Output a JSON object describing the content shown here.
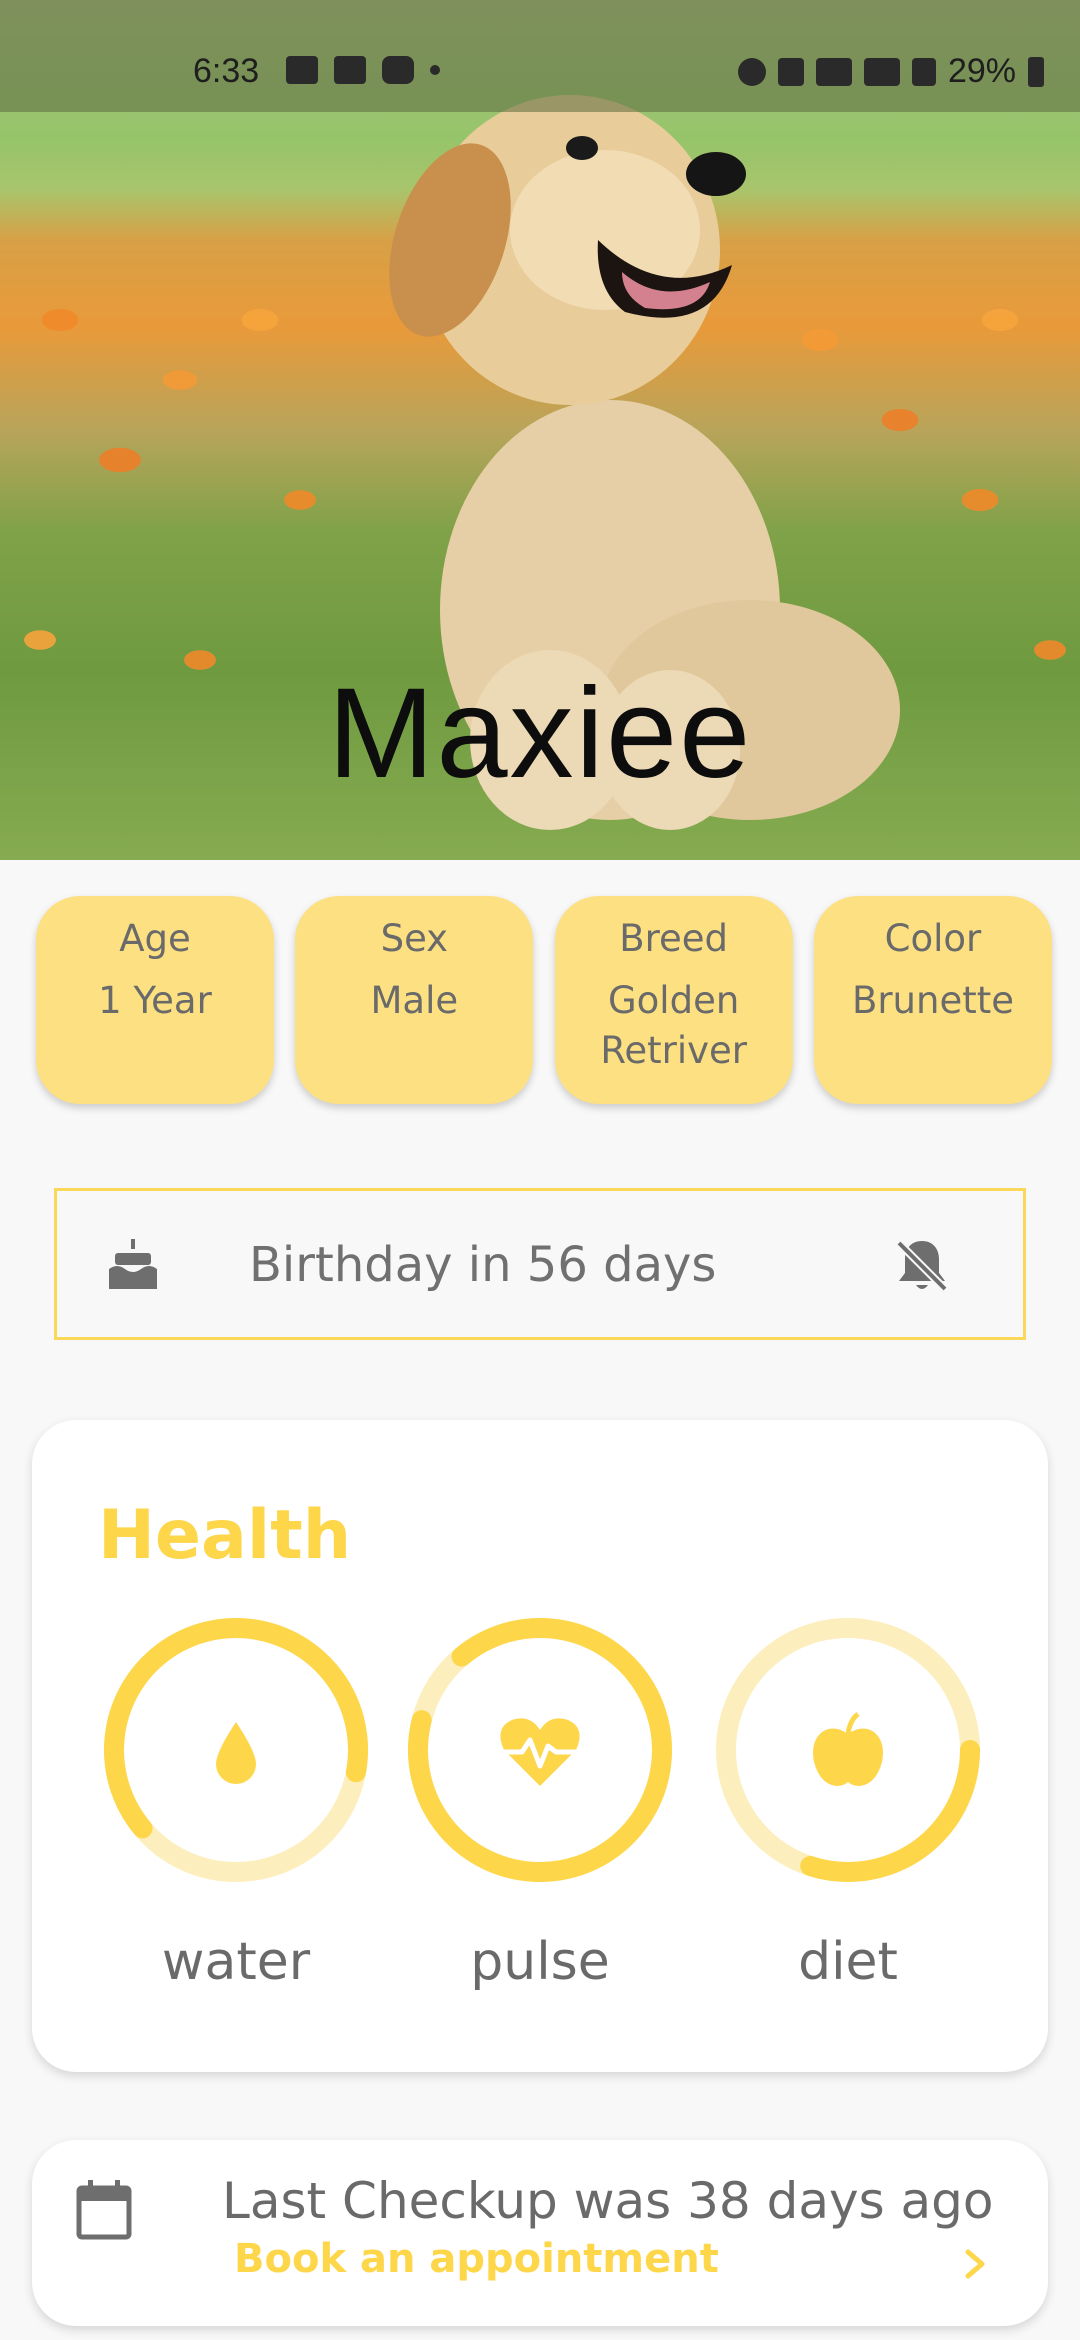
{
  "status_bar": {
    "time": "6:33",
    "battery": "29%",
    "icons_left": [
      "gallery-icon",
      "calendar-icon",
      "youtube-icon",
      "dot-icon"
    ],
    "icons_right": [
      "alarm-icon",
      "mute-icon",
      "wifi-icon",
      "wifi-calling-icon",
      "signal-icon",
      "battery-icon"
    ]
  },
  "pet": {
    "name": "Maxiee"
  },
  "info_cards": [
    {
      "label": "Age",
      "value": "1 Year"
    },
    {
      "label": "Sex",
      "value": "Male"
    },
    {
      "label": "Breed",
      "value": "Golden Retriver"
    },
    {
      "label": "Color",
      "value": "Brunette"
    }
  ],
  "birthday": {
    "text": "Birthday in 56 days",
    "icon": "cake-icon",
    "action_icon": "bell-off-icon"
  },
  "health": {
    "title": "Health",
    "metrics": [
      {
        "label": "water",
        "icon": "water-drop-icon",
        "progress": 0.64
      },
      {
        "label": "pulse",
        "icon": "heart-pulse-icon",
        "progress": 0.9
      },
      {
        "label": "diet",
        "icon": "apple-icon",
        "progress": 0.3
      }
    ]
  },
  "checkup": {
    "text": "Last Checkup was 38 days ago",
    "link": "Book an appointment",
    "icon": "calendar-icon",
    "action_icon": "chevron-right-icon"
  },
  "colors": {
    "accent": "#fdd64a",
    "card": "#fde082",
    "ring_track": "#fdeebd",
    "text_gray": "#6a6a6a"
  }
}
